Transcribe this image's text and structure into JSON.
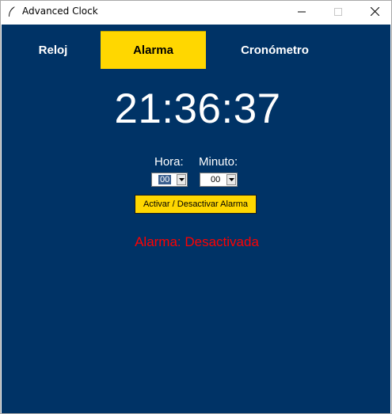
{
  "window": {
    "title": "Advanced Clock",
    "icon": "feather-icon",
    "controls": [
      "minimize-icon",
      "maximize-icon",
      "close-icon"
    ]
  },
  "tabs": [
    {
      "label": "Reloj",
      "active": false
    },
    {
      "label": "Alarma",
      "active": true
    },
    {
      "label": "Cronómetro",
      "active": false
    }
  ],
  "clock": {
    "time": "21:36:37"
  },
  "alarm": {
    "hour_label": "Hora:",
    "minute_label": "Minuto:",
    "hour_value": "00",
    "minute_value": "00",
    "toggle_button": "Activar / Desactivar Alarma",
    "status": "Alarma: Desactivada"
  },
  "colors": {
    "background": "#003366",
    "accent": "#ffd700",
    "status": "#ff0000",
    "text": "#ffffff"
  }
}
